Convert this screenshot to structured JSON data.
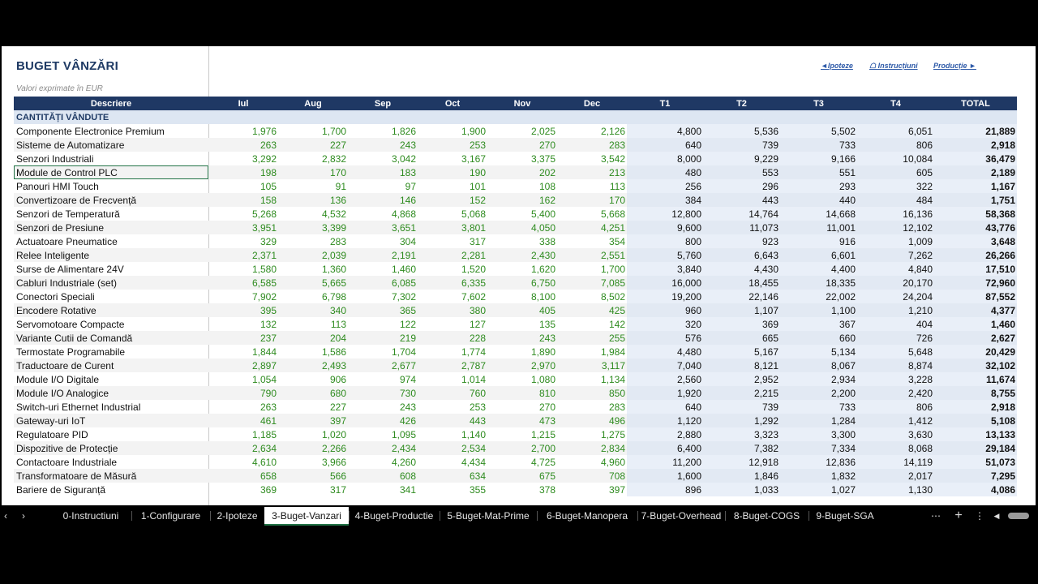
{
  "title": "BUGET VÂNZĂRI",
  "subtitle": "Valori exprimate în EUR",
  "nav": {
    "ipoteze": "◄Ipoteze",
    "instructiuni": "☖ Instrucțiuni",
    "productie": "Producție ►"
  },
  "headers": [
    "Descriere",
    "Iul",
    "Aug",
    "Sep",
    "Oct",
    "Nov",
    "Dec",
    "T1",
    "T2",
    "T3",
    "T4",
    "TOTAL"
  ],
  "section_label": "CANTITĂȚI VÂNDUTE",
  "rows": [
    [
      "Componente Electronice Premium",
      "1,976",
      "1,700",
      "1,826",
      "1,900",
      "2,025",
      "2,126",
      "4,800",
      "5,536",
      "5,502",
      "6,051",
      "21,889"
    ],
    [
      "Sisteme de Automatizare",
      "263",
      "227",
      "243",
      "253",
      "270",
      "283",
      "640",
      "739",
      "733",
      "806",
      "2,918"
    ],
    [
      "Senzori Industriali",
      "3,292",
      "2,832",
      "3,042",
      "3,167",
      "3,375",
      "3,542",
      "8,000",
      "9,229",
      "9,166",
      "10,084",
      "36,479"
    ],
    [
      "Module de Control PLC",
      "198",
      "170",
      "183",
      "190",
      "202",
      "213",
      "480",
      "553",
      "551",
      "605",
      "2,189"
    ],
    [
      "Panouri HMI Touch",
      "105",
      "91",
      "97",
      "101",
      "108",
      "113",
      "256",
      "296",
      "293",
      "322",
      "1,167"
    ],
    [
      "Convertizoare de Frecvență",
      "158",
      "136",
      "146",
      "152",
      "162",
      "170",
      "384",
      "443",
      "440",
      "484",
      "1,751"
    ],
    [
      "Senzori de Temperatură",
      "5,268",
      "4,532",
      "4,868",
      "5,068",
      "5,400",
      "5,668",
      "12,800",
      "14,764",
      "14,668",
      "16,136",
      "58,368"
    ],
    [
      "Senzori de Presiune",
      "3,951",
      "3,399",
      "3,651",
      "3,801",
      "4,050",
      "4,251",
      "9,600",
      "11,073",
      "11,001",
      "12,102",
      "43,776"
    ],
    [
      "Actuatoare Pneumatice",
      "329",
      "283",
      "304",
      "317",
      "338",
      "354",
      "800",
      "923",
      "916",
      "1,009",
      "3,648"
    ],
    [
      "Relee Inteligente",
      "2,371",
      "2,039",
      "2,191",
      "2,281",
      "2,430",
      "2,551",
      "5,760",
      "6,643",
      "6,601",
      "7,262",
      "26,266"
    ],
    [
      "Surse de Alimentare 24V",
      "1,580",
      "1,360",
      "1,460",
      "1,520",
      "1,620",
      "1,700",
      "3,840",
      "4,430",
      "4,400",
      "4,840",
      "17,510"
    ],
    [
      "Cabluri Industriale (set)",
      "6,585",
      "5,665",
      "6,085",
      "6,335",
      "6,750",
      "7,085",
      "16,000",
      "18,455",
      "18,335",
      "20,170",
      "72,960"
    ],
    [
      "Conectori Speciali",
      "7,902",
      "6,798",
      "7,302",
      "7,602",
      "8,100",
      "8,502",
      "19,200",
      "22,146",
      "22,002",
      "24,204",
      "87,552"
    ],
    [
      "Encodere Rotative",
      "395",
      "340",
      "365",
      "380",
      "405",
      "425",
      "960",
      "1,107",
      "1,100",
      "1,210",
      "4,377"
    ],
    [
      "Servomotoare Compacte",
      "132",
      "113",
      "122",
      "127",
      "135",
      "142",
      "320",
      "369",
      "367",
      "404",
      "1,460"
    ],
    [
      "Variante Cutii de Comandă",
      "237",
      "204",
      "219",
      "228",
      "243",
      "255",
      "576",
      "665",
      "660",
      "726",
      "2,627"
    ],
    [
      "Termostate Programabile",
      "1,844",
      "1,586",
      "1,704",
      "1,774",
      "1,890",
      "1,984",
      "4,480",
      "5,167",
      "5,134",
      "5,648",
      "20,429"
    ],
    [
      "Traductoare de Curent",
      "2,897",
      "2,493",
      "2,677",
      "2,787",
      "2,970",
      "3,117",
      "7,040",
      "8,121",
      "8,067",
      "8,874",
      "32,102"
    ],
    [
      "Module I/O Digitale",
      "1,054",
      "906",
      "974",
      "1,014",
      "1,080",
      "1,134",
      "2,560",
      "2,952",
      "2,934",
      "3,228",
      "11,674"
    ],
    [
      "Module I/O Analogice",
      "790",
      "680",
      "730",
      "760",
      "810",
      "850",
      "1,920",
      "2,215",
      "2,200",
      "2,420",
      "8,755"
    ],
    [
      "Switch-uri Ethernet Industrial",
      "263",
      "227",
      "243",
      "253",
      "270",
      "283",
      "640",
      "739",
      "733",
      "806",
      "2,918"
    ],
    [
      "Gateway-uri IoT",
      "461",
      "397",
      "426",
      "443",
      "473",
      "496",
      "1,120",
      "1,292",
      "1,284",
      "1,412",
      "5,108"
    ],
    [
      "Regulatoare PID",
      "1,185",
      "1,020",
      "1,095",
      "1,140",
      "1,215",
      "1,275",
      "2,880",
      "3,323",
      "3,300",
      "3,630",
      "13,133"
    ],
    [
      "Dispozitive de Protecție",
      "2,634",
      "2,266",
      "2,434",
      "2,534",
      "2,700",
      "2,834",
      "6,400",
      "7,382",
      "7,334",
      "8,068",
      "29,184"
    ],
    [
      "Contactoare Industriale",
      "4,610",
      "3,966",
      "4,260",
      "4,434",
      "4,725",
      "4,960",
      "11,200",
      "12,918",
      "12,836",
      "14,119",
      "51,073"
    ],
    [
      "Transformatoare de Măsură",
      "658",
      "566",
      "608",
      "634",
      "675",
      "708",
      "1,600",
      "1,846",
      "1,832",
      "2,017",
      "7,295"
    ],
    [
      "Bariere de Siguranță",
      "369",
      "317",
      "341",
      "355",
      "378",
      "397",
      "896",
      "1,033",
      "1,027",
      "1,130",
      "4,086"
    ]
  ],
  "tabs": [
    "0-Instructiuni",
    "1-Configurare",
    "2-Ipoteze",
    "3-Buget-Vanzari",
    "4-Buget-Productie",
    "5-Buget-Mat-Prime",
    "6-Buget-Manopera",
    "7-Buget-Overhead",
    "8-Buget-COGS",
    "9-Buget-SGA"
  ],
  "active_tab": "3-Buget-Vanzari",
  "controls": {
    "prev": "‹",
    "next": "›",
    "more": "⋯",
    "add": "+",
    "menu": "⋮",
    "scroll_left": "◀"
  },
  "colors": {
    "header_bg": "#1f3864",
    "accent_green": "#217346",
    "month_text": "#2e8b1f"
  }
}
